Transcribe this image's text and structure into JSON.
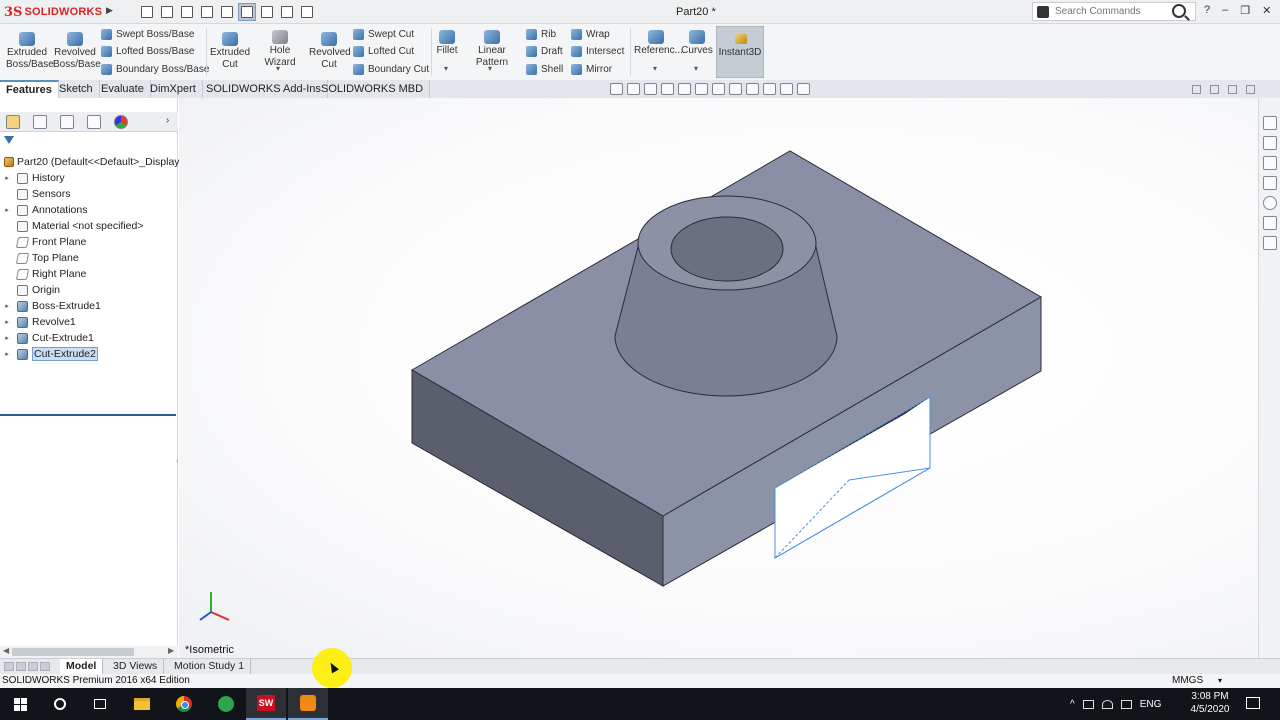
{
  "app": {
    "logo_ds": "3S",
    "logo_text": "SOLIDWORKS",
    "doc_title": "Part20 *",
    "search_placeholder": "Search Commands"
  },
  "toolbar": {
    "extruded_boss": [
      "Extruded",
      "Boss/Base"
    ],
    "revolved_boss": [
      "Revolved",
      "Boss/Base"
    ],
    "swept_boss": "Swept Boss/Base",
    "lofted_boss": "Lofted Boss/Base",
    "boundary_boss": "Boundary Boss/Base",
    "extruded_cut": [
      "Extruded",
      "Cut"
    ],
    "hole_wizard": "Hole Wizard",
    "revolved_cut": [
      "Revolved",
      "Cut"
    ],
    "swept_cut": "Swept Cut",
    "lofted_cut": "Lofted Cut",
    "boundary_cut": "Boundary Cut",
    "fillet": "Fillet",
    "linear_pattern": "Linear Pattern",
    "rib": "Rib",
    "draft": "Draft",
    "shell": "Shell",
    "wrap": "Wrap",
    "intersect": "Intersect",
    "mirror": "Mirror",
    "reference": "Referenc...",
    "curves": "Curves",
    "instant3d": "Instant3D"
  },
  "tabs": [
    "Features",
    "Sketch",
    "Evaluate",
    "DimXpert",
    "SOLIDWORKS Add-Ins",
    "SOLIDWORKS MBD"
  ],
  "tree": {
    "root": "Part20  (Default<<Default>_Display",
    "items": [
      {
        "label": "History",
        "icon": "history-icon",
        "expandable": true
      },
      {
        "label": "Sensors",
        "icon": "sensors-icon",
        "expandable": false
      },
      {
        "label": "Annotations",
        "icon": "annotations-icon",
        "expandable": true
      },
      {
        "label": "Material <not specified>",
        "icon": "material-icon",
        "expandable": false
      },
      {
        "label": "Front Plane",
        "icon": "plane-icon",
        "expandable": false
      },
      {
        "label": "Top Plane",
        "icon": "plane-icon",
        "expandable": false
      },
      {
        "label": "Right Plane",
        "icon": "plane-icon",
        "expandable": false
      },
      {
        "label": "Origin",
        "icon": "origin-icon",
        "expandable": false
      },
      {
        "label": "Boss-Extrude1",
        "icon": "boss-extrude-icon",
        "expandable": true
      },
      {
        "label": "Revolve1",
        "icon": "revolve-icon",
        "expandable": true
      },
      {
        "label": "Cut-Extrude1",
        "icon": "cut-extrude-icon",
        "expandable": true
      },
      {
        "label": "Cut-Extrude2",
        "icon": "cut-extrude-icon",
        "expandable": true,
        "selected": true
      }
    ]
  },
  "viewport": {
    "view_label": "*Isometric"
  },
  "bottom_tabs": [
    "Model",
    "3D Views",
    "Motion Study 1"
  ],
  "status": {
    "edition": "SOLIDWORKS Premium 2016 x64 Edition",
    "units": "MMGS"
  },
  "taskbar": {
    "language": "ENG",
    "time": "3:08 PM",
    "date": "4/5/2020",
    "sw_label": "SW"
  },
  "colors": {
    "accent": "#5b8ec7",
    "part_top": "#8a8fa5",
    "part_side_left": "#5a5e6d",
    "part_side_front": "#8d93a6",
    "sketch_line": "#4a90e2",
    "cursor_highlight": "#ffee00"
  }
}
